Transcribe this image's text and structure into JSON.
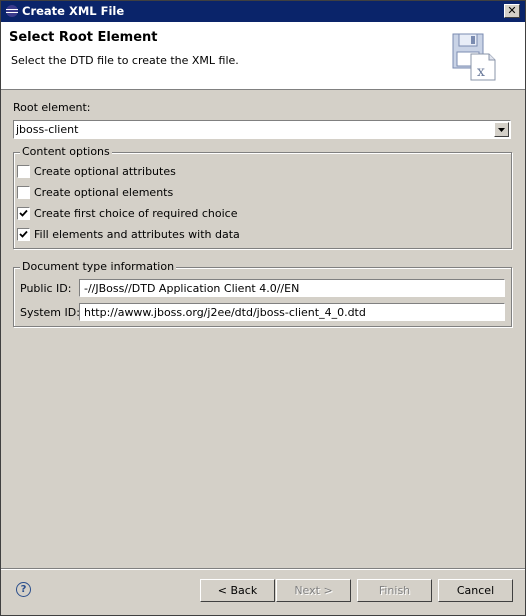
{
  "window": {
    "title": "Create XML File"
  },
  "header": {
    "title": "Select Root Element",
    "description": "Select the DTD file to create the XML file."
  },
  "root": {
    "label": "Root element:",
    "value": "jboss-client"
  },
  "content_options": {
    "legend": "Content options",
    "items": [
      {
        "label": "Create optional attributes",
        "checked": false
      },
      {
        "label": "Create optional elements",
        "checked": false
      },
      {
        "label": "Create first choice of required choice",
        "checked": true
      },
      {
        "label": "Fill elements and attributes with data",
        "checked": true
      }
    ]
  },
  "doctype": {
    "legend": "Document type information",
    "public_label": "Public ID:",
    "public_value": "-//JBoss//DTD Application Client 4.0//EN",
    "system_label": "System ID:",
    "system_value": "http://awww.jboss.org/j2ee/dtd/jboss-client_4_0.dtd"
  },
  "buttons": {
    "back": "< Back",
    "next": "Next >",
    "finish": "Finish",
    "cancel": "Cancel",
    "help": "?"
  }
}
